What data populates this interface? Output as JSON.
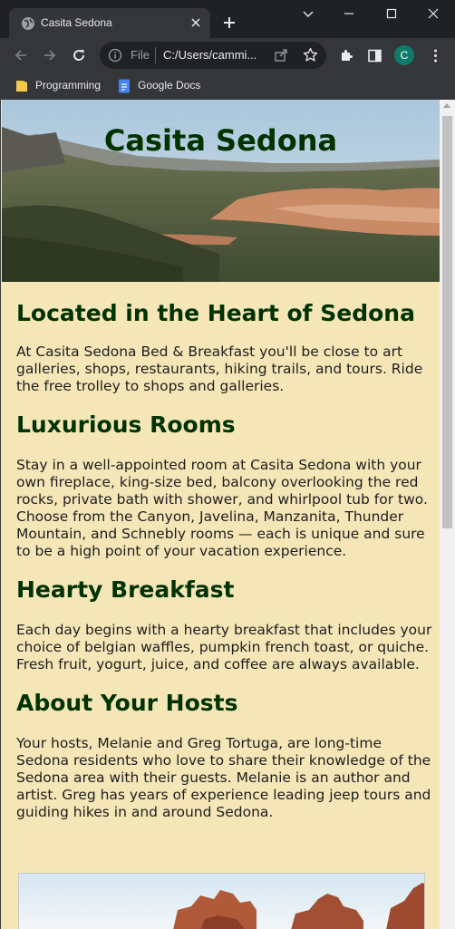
{
  "browser": {
    "tab_title": "Casita Sedona",
    "address_scheme": "File",
    "address_url": "C:/Users/cammi...",
    "profile_initial": "C",
    "bookmarks": [
      {
        "label": "Programming",
        "icon": "folder-icon"
      },
      {
        "label": "Google Docs",
        "icon": "google-docs-icon"
      }
    ]
  },
  "page": {
    "banner_title": "Casita Sedona",
    "sections": [
      {
        "heading": "Located in the Heart of Sedona",
        "body": "At Casita Sedona Bed & Breakfast you'll be close to art galleries, shops, restaurants, hiking trails, and tours. Ride the free trolley to shops and galleries."
      },
      {
        "heading": "Luxurious Rooms",
        "body": "Stay in a well-appointed room at Casita Sedona with your own fireplace, king-size bed, balcony overlooking the red rocks, private bath with shower, and whirlpool tub for two. Choose from the Canyon, Javelina, Manzanita, Thunder Mountain, and Schnebly rooms — each is unique and sure to be a high point of your vacation experience."
      },
      {
        "heading": "Hearty Breakfast",
        "body": "Each day begins with a hearty breakfast that includes your choice of belgian waffles, pumpkin french toast, or quiche. Fresh fruit, yogurt, juice, and coffee are always available."
      },
      {
        "heading": "About Your Hosts",
        "body": "Your hosts, Melanie and Greg Tortuga, are long-time Sedona residents who love to share their knowledge of the Sedona area with their guests. Melanie is an author and artist. Greg has years of experience leading jeep tours and guiding hikes in and around Sedona."
      }
    ]
  },
  "colors": {
    "page_background": "#f5e6b8",
    "heading": "#003300",
    "chrome_dark": "#202124",
    "chrome_toolbar": "#35363a",
    "profile": "#0f7b6c"
  }
}
